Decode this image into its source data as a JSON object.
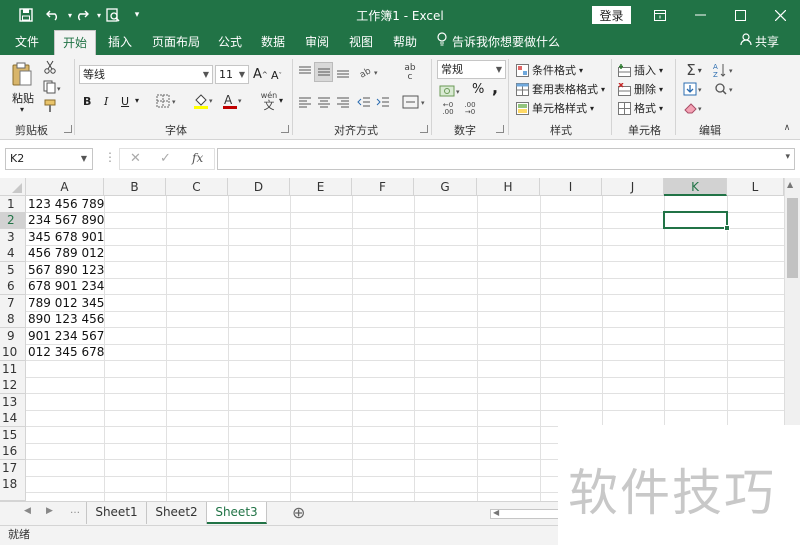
{
  "titlebar": {
    "title": "工作簿1 - Excel",
    "login": "登录",
    "quick_access": [
      "save-icon",
      "undo-icon",
      "redo-icon",
      "print-preview-icon",
      "customize-icon"
    ]
  },
  "menu": {
    "tabs": [
      "文件",
      "开始",
      "插入",
      "页面布局",
      "公式",
      "数据",
      "审阅",
      "视图",
      "帮助"
    ],
    "active": "开始",
    "tell_me": "告诉我你想要做什么",
    "share": "共享"
  },
  "ribbon": {
    "clipboard": {
      "paste": "粘贴",
      "label": "剪贴板"
    },
    "font": {
      "name": "等线",
      "size": "11",
      "label": "字体",
      "bold": "B",
      "italic": "I",
      "underline": "U",
      "wen": "wén",
      "wen_char": "文",
      "grow": "A",
      "shrink": "A"
    },
    "alignment": {
      "label": "对齐方式",
      "wrap": "ab",
      "wrap_sub": "c"
    },
    "number": {
      "format": "常规",
      "label": "数字",
      "percent": "%",
      "comma": ","
    },
    "styles": {
      "conditional": "条件格式",
      "table": "套用表格格式",
      "cell": "单元格样式",
      "label": "样式"
    },
    "cells": {
      "insert": "插入",
      "delete": "删除",
      "format": "格式",
      "label": "单元格"
    },
    "editing": {
      "label": "编辑"
    }
  },
  "formula_bar": {
    "name_box": "K2",
    "value": ""
  },
  "grid": {
    "columns": [
      "A",
      "B",
      "C",
      "D",
      "E",
      "F",
      "G",
      "H",
      "I",
      "J",
      "K",
      "L"
    ],
    "rows": [
      "1",
      "2",
      "3",
      "4",
      "5",
      "6",
      "7",
      "8",
      "9",
      "10",
      "11",
      "12",
      "13",
      "14",
      "15",
      "16",
      "17",
      "18"
    ],
    "column_a": [
      "123 456 789",
      "234 567 890",
      "345 678 901",
      "456 789 012",
      "567 890 123",
      "678 901 234",
      "789 012 345",
      "890 123 456",
      "901 234 567",
      "012 345 678"
    ],
    "selected_column": "K",
    "selected_row": "2"
  },
  "sheets": {
    "tabs": [
      "Sheet1",
      "Sheet2",
      "Sheet3"
    ],
    "active": "Sheet3",
    "add": "⊕"
  },
  "status": {
    "text": "就绪"
  },
  "watermark": "软件技巧",
  "colors": {
    "brand": "#217346",
    "ribbon": "#f3f3f3",
    "font_color_red": "#c00000",
    "highlight_yellow": "#ffff00"
  }
}
